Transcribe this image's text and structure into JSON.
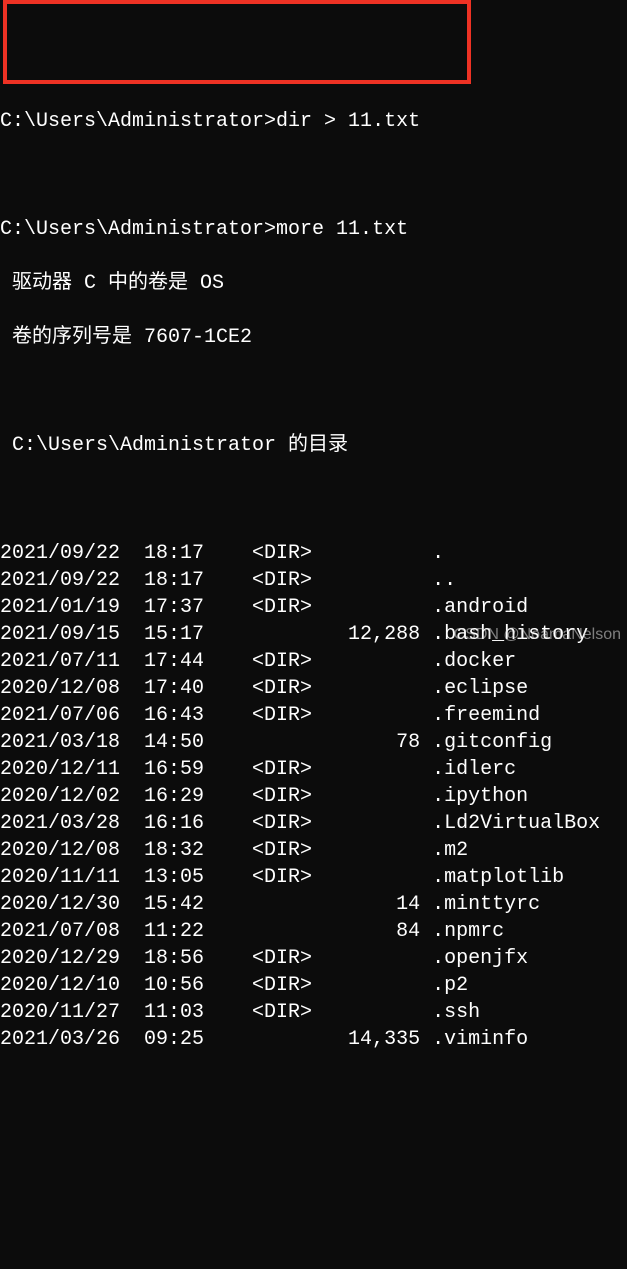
{
  "prompt1": {
    "path": "C:\\Users\\Administrator>",
    "cmd": "dir > 11.txt"
  },
  "prompt2": {
    "path": "C:\\Users\\Administrator>",
    "cmd": "more 11.txt"
  },
  "vol_line": " 驱动器 C 中的卷是 OS",
  "serial_line": " 卷的序列号是 7607-1CE2",
  "dir_of_line": " C:\\Users\\Administrator 的目录",
  "entries": [
    {
      "date": "2021/09/22",
      "time": "18:17",
      "type": "<DIR>",
      "size": "",
      "name": "."
    },
    {
      "date": "2021/09/22",
      "time": "18:17",
      "type": "<DIR>",
      "size": "",
      "name": ".."
    },
    {
      "date": "2021/01/19",
      "time": "17:37",
      "type": "<DIR>",
      "size": "",
      "name": ".android"
    },
    {
      "date": "2021/09/15",
      "time": "15:17",
      "type": "",
      "size": "12,288",
      "name": ".bash_history"
    },
    {
      "date": "2021/07/11",
      "time": "17:44",
      "type": "<DIR>",
      "size": "",
      "name": ".docker"
    },
    {
      "date": "2020/12/08",
      "time": "17:40",
      "type": "<DIR>",
      "size": "",
      "name": ".eclipse"
    },
    {
      "date": "2021/07/06",
      "time": "16:43",
      "type": "<DIR>",
      "size": "",
      "name": ".freemind"
    },
    {
      "date": "2021/03/18",
      "time": "14:50",
      "type": "",
      "size": "78",
      "name": ".gitconfig"
    },
    {
      "date": "2020/12/11",
      "time": "16:59",
      "type": "<DIR>",
      "size": "",
      "name": ".idlerc"
    },
    {
      "date": "2020/12/02",
      "time": "16:29",
      "type": "<DIR>",
      "size": "",
      "name": ".ipython"
    },
    {
      "date": "2021/03/28",
      "time": "16:16",
      "type": "<DIR>",
      "size": "",
      "name": ".Ld2VirtualBox"
    },
    {
      "date": "2020/12/08",
      "time": "18:32",
      "type": "<DIR>",
      "size": "",
      "name": ".m2"
    },
    {
      "date": "2020/11/11",
      "time": "13:05",
      "type": "<DIR>",
      "size": "",
      "name": ".matplotlib"
    },
    {
      "date": "2020/12/30",
      "time": "15:42",
      "type": "",
      "size": "14",
      "name": ".minttyrc"
    },
    {
      "date": "2021/07/08",
      "time": "11:22",
      "type": "",
      "size": "84",
      "name": ".npmrc"
    },
    {
      "date": "2020/12/29",
      "time": "18:56",
      "type": "<DIR>",
      "size": "",
      "name": ".openjfx"
    },
    {
      "date": "2020/12/10",
      "time": "10:56",
      "type": "<DIR>",
      "size": "",
      "name": ".p2"
    },
    {
      "date": "2020/11/27",
      "time": "11:03",
      "type": "<DIR>",
      "size": "",
      "name": ".ssh"
    },
    {
      "date": "2021/03/26",
      "time": "09:25",
      "type": "",
      "size": "14,335",
      "name": ".viminfo"
    }
  ],
  "watermark": "CSDN @NoamaNelson"
}
